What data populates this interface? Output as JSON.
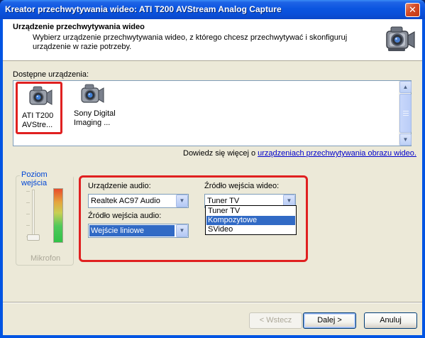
{
  "window": {
    "title": "Kreator przechwytywania wideo: ATI T200 AVStream Analog Capture",
    "close_glyph": "✕"
  },
  "header": {
    "title": "Urządzenie przechwytywania wideo",
    "description": "Wybierz urządzenie przechwytywania wideo, z którego chcesz przechwytywać i skonfiguruj urządzenie w razie potrzeby.",
    "icon": "camcorder-icon"
  },
  "devices": {
    "label": "Dostępne urządzenia:",
    "items": [
      {
        "name": "ATI T200\nAVStre...",
        "icon": "webcam-icon",
        "selected": true
      },
      {
        "name": "Sony Digital\nImaging ...",
        "icon": "webcam-icon",
        "selected": false
      }
    ]
  },
  "info": {
    "prefix": "Dowiedz się więcej o ",
    "link": "urządzeniach przechwytywania obrazu wideo."
  },
  "level": {
    "legend": "Poziom wejścia",
    "mic_label": "Mikrofon"
  },
  "audio": {
    "device_label": "Urządzenie audio:",
    "device_value": "Realtek AC97 Audio",
    "input_label": "Źródło wejścia audio:",
    "input_value": "Wejście liniowe"
  },
  "video": {
    "input_label": "Źródło wejścia wideo:",
    "input_value": "Tuner TV",
    "options": [
      "Tuner TV",
      "Kompozytowe",
      "SVideo"
    ],
    "highlighted_index": 1
  },
  "buttons": {
    "back": "< Wstecz",
    "next": "Dalej >",
    "cancel": "Anuluj"
  },
  "colors": {
    "highlight": "#316ac5",
    "annotation_red": "#e02020",
    "link": "#0000cc"
  }
}
